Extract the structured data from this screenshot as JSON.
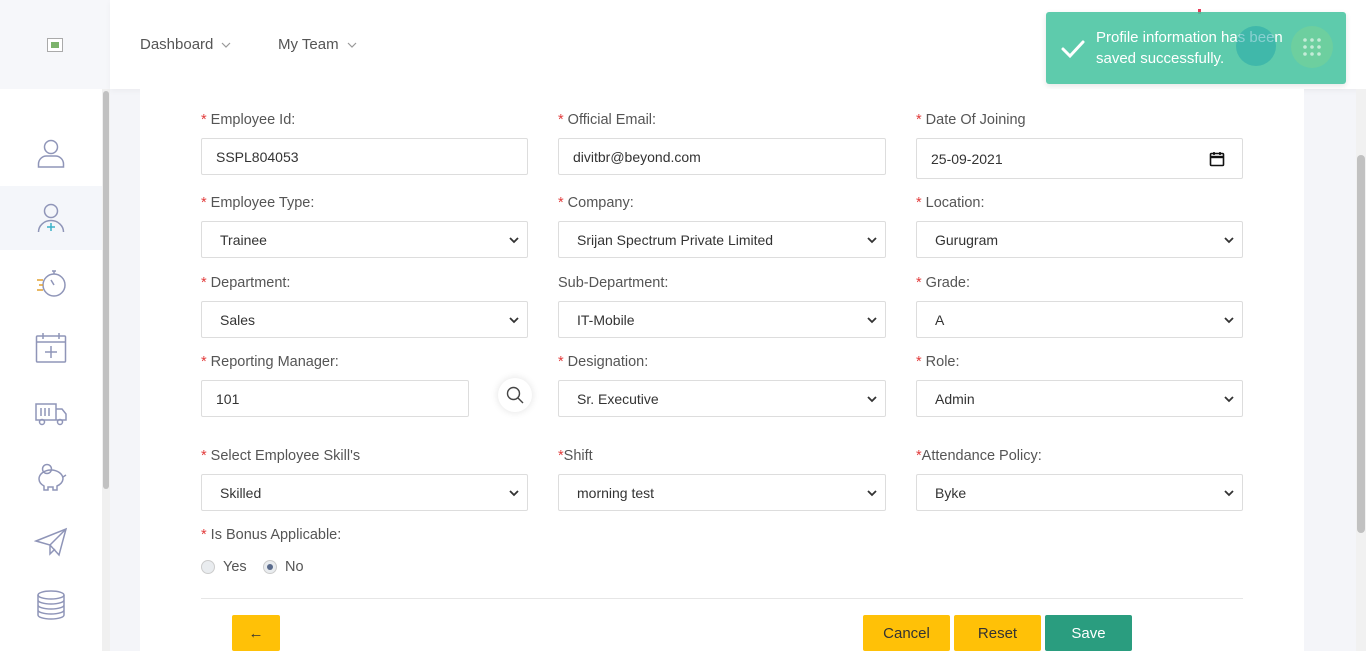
{
  "header": {
    "menu": [
      {
        "label": "Dashboard"
      },
      {
        "label": "My Team"
      }
    ]
  },
  "toast": {
    "message": "Profile information has been saved successfully."
  },
  "sidebar": {
    "items": [
      {
        "icon": "user-icon"
      },
      {
        "icon": "add-user-icon"
      },
      {
        "icon": "stopwatch-icon"
      },
      {
        "icon": "calendar-plus-icon"
      },
      {
        "icon": "truck-icon"
      },
      {
        "icon": "piggy-bank-icon"
      },
      {
        "icon": "paper-plane-icon"
      },
      {
        "icon": "coins-stack-icon"
      }
    ]
  },
  "form": {
    "employee_id": {
      "label": "Employee Id:",
      "value": "SSPL804053"
    },
    "official_email": {
      "label": "Official Email:",
      "value": "divitbr@beyond.com"
    },
    "date_of_joining": {
      "label": "Date Of Joining",
      "value": "25-09-2021"
    },
    "employee_type": {
      "label": "Employee Type:",
      "value": "Trainee"
    },
    "company": {
      "label": "Company:",
      "value": "Srijan Spectrum Private Limited"
    },
    "location": {
      "label": "Location:",
      "value": "Gurugram"
    },
    "department": {
      "label": "Department:",
      "value": "Sales"
    },
    "sub_department": {
      "label": "Sub-Department:",
      "value": "IT-Mobile"
    },
    "grade": {
      "label": "Grade:",
      "value": "A"
    },
    "reporting_manager": {
      "label": "Reporting Manager:",
      "value": "101"
    },
    "designation": {
      "label": "Designation:",
      "value": "Sr. Executive"
    },
    "role": {
      "label": "Role:",
      "value": "Admin"
    },
    "skills": {
      "label": "Select Employee Skill's",
      "value": "Skilled"
    },
    "shift": {
      "label": "Shift",
      "value": "morning test"
    },
    "attendance_policy": {
      "label": "Attendance Policy:",
      "value": "Byke"
    },
    "bonus": {
      "label": "Is Bonus Applicable:",
      "yes": "Yes",
      "no": "No",
      "selected": "No"
    }
  },
  "buttons": {
    "back": "←",
    "cancel": "Cancel",
    "reset": "Reset",
    "save": "Save"
  },
  "colors": {
    "accent_yellow": "#ffc107",
    "save_green": "#2a9d7f",
    "toast_green": "#48c4a0",
    "required_red": "#e23b3b"
  }
}
